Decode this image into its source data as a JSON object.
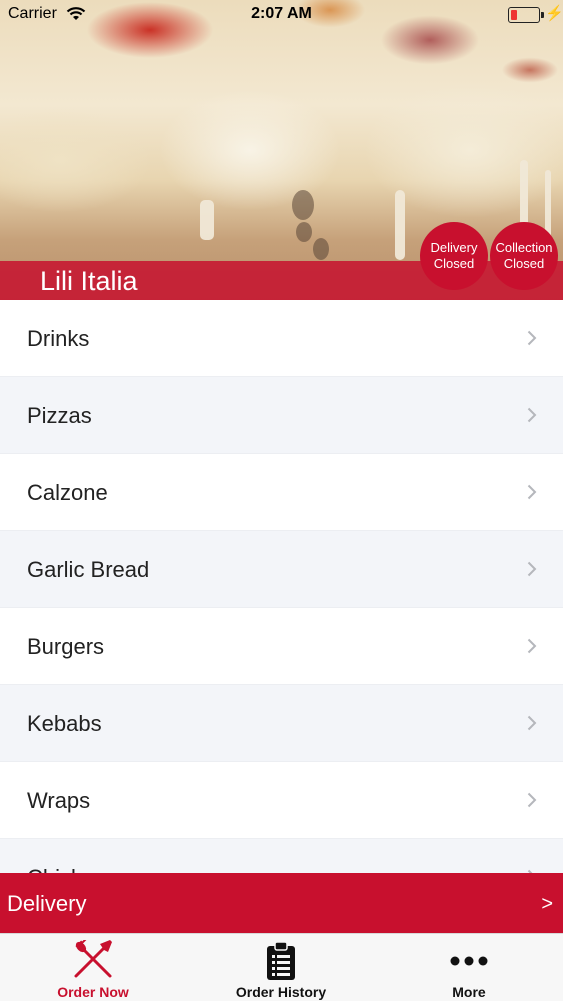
{
  "status_bar": {
    "carrier": "Carrier",
    "time": "2:07 AM"
  },
  "restaurant": {
    "name": "Lili Italia"
  },
  "badges": {
    "delivery": {
      "line1": "Delivery",
      "line2": "Closed"
    },
    "collection": {
      "line1": "Collection",
      "line2": "Closed"
    }
  },
  "menu": {
    "items": [
      {
        "label": "Drinks"
      },
      {
        "label": "Pizzas"
      },
      {
        "label": "Calzone"
      },
      {
        "label": "Garlic Bread"
      },
      {
        "label": "Burgers"
      },
      {
        "label": "Kebabs"
      },
      {
        "label": "Wraps"
      },
      {
        "label": "Chicken"
      }
    ]
  },
  "delivery_bar": {
    "label": "Delivery",
    "arrow": ">"
  },
  "tabbar": {
    "tabs": [
      {
        "label": "Order Now",
        "icon": "fork-knife-icon",
        "active": true
      },
      {
        "label": "Order History",
        "icon": "clipboard-list-icon",
        "active": false
      },
      {
        "label": "More",
        "icon": "more-dots-icon",
        "active": false
      }
    ]
  },
  "colors": {
    "brand_red": "#c8102e",
    "active_tab": "#c8102e",
    "text": "#222222"
  }
}
